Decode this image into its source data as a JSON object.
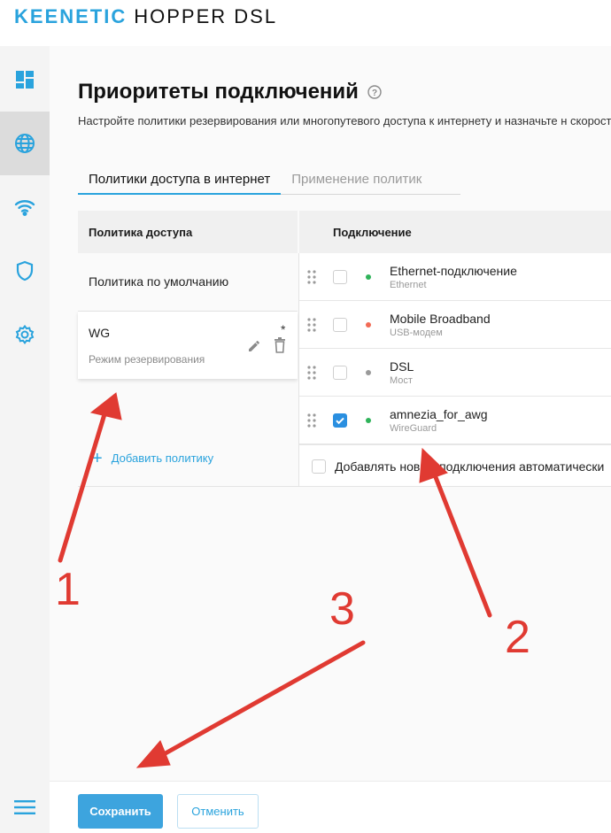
{
  "header": {
    "brand": "KEENETIC",
    "model": "HOPPER DSL"
  },
  "sidebar": {
    "items": [
      {
        "icon": "dashboard-icon",
        "active": false
      },
      {
        "icon": "globe-icon",
        "active": true
      },
      {
        "icon": "wifi-icon",
        "active": false
      },
      {
        "icon": "shield-icon",
        "active": false
      },
      {
        "icon": "gear-icon",
        "active": false
      }
    ],
    "menu_icon": "menu-icon"
  },
  "page": {
    "title": "Приоритеты подключений",
    "description": "Настройте политики резервирования или многопутевого доступа к интернету и назначьте н скорости."
  },
  "tabs": [
    {
      "label": "Политики доступа в интернет",
      "active": true
    },
    {
      "label": "Применение политик",
      "active": false
    }
  ],
  "policies": {
    "header": "Политика доступа",
    "items": [
      {
        "name": "Политика по умолчанию",
        "subtitle": ""
      },
      {
        "name": "WG",
        "subtitle": "Режим резервирования",
        "modified_marker": "*"
      }
    ],
    "add_label": "Добавить политику"
  },
  "connections": {
    "header": "Подключение",
    "items": [
      {
        "name": "Ethernet-подключение",
        "type": "Ethernet",
        "checked": false,
        "status_color": "#2fb35a"
      },
      {
        "name": "Mobile Broadband",
        "type": "USB-модем",
        "checked": false,
        "status_color": "#f26a55"
      },
      {
        "name": "DSL",
        "type": "Мост",
        "checked": false,
        "status_color": "#9a9a9a"
      },
      {
        "name": "amnezia_for_awg",
        "type": "WireGuard",
        "checked": true,
        "status_color": "#2fb35a"
      }
    ],
    "auto_add_label": "Добавлять новые подключения автоматически"
  },
  "footer": {
    "save_label": "Сохранить",
    "cancel_label": "Отменить"
  },
  "annotations": {
    "colors": {
      "arrow": "#e03a32"
    },
    "labels": [
      "1",
      "2",
      "3"
    ]
  },
  "colors": {
    "accent": "#2aa3dd",
    "checkbox_on": "#2a8fe0"
  }
}
